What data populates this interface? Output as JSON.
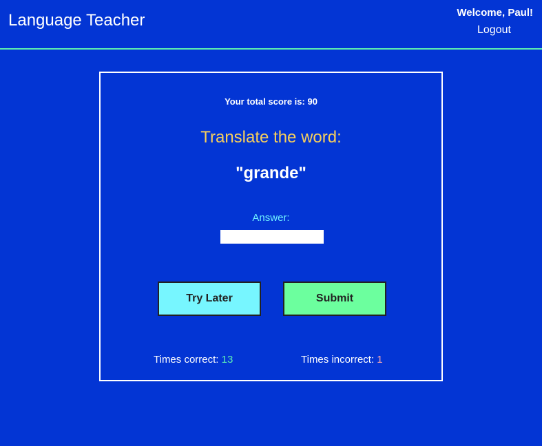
{
  "header": {
    "title": "Language Teacher",
    "welcome": "Welcome, Paul!",
    "logout": "Logout"
  },
  "quiz": {
    "score_text": "Your total score is: 90",
    "prompt": "Translate the word:",
    "word": "\"grande\"",
    "answer_label": "Answer:",
    "answer_value": "",
    "try_later": "Try Later",
    "submit": "Submit",
    "correct_label": "Times correct: ",
    "correct_value": "13",
    "incorrect_label": "Times incorrect: ",
    "incorrect_value": "1"
  },
  "colors": {
    "background": "#0335d4",
    "accent_line": "#5cf0b0",
    "prompt": "#f7cf5c",
    "try_later": "#77f6ff",
    "submit": "#6cff9e"
  }
}
